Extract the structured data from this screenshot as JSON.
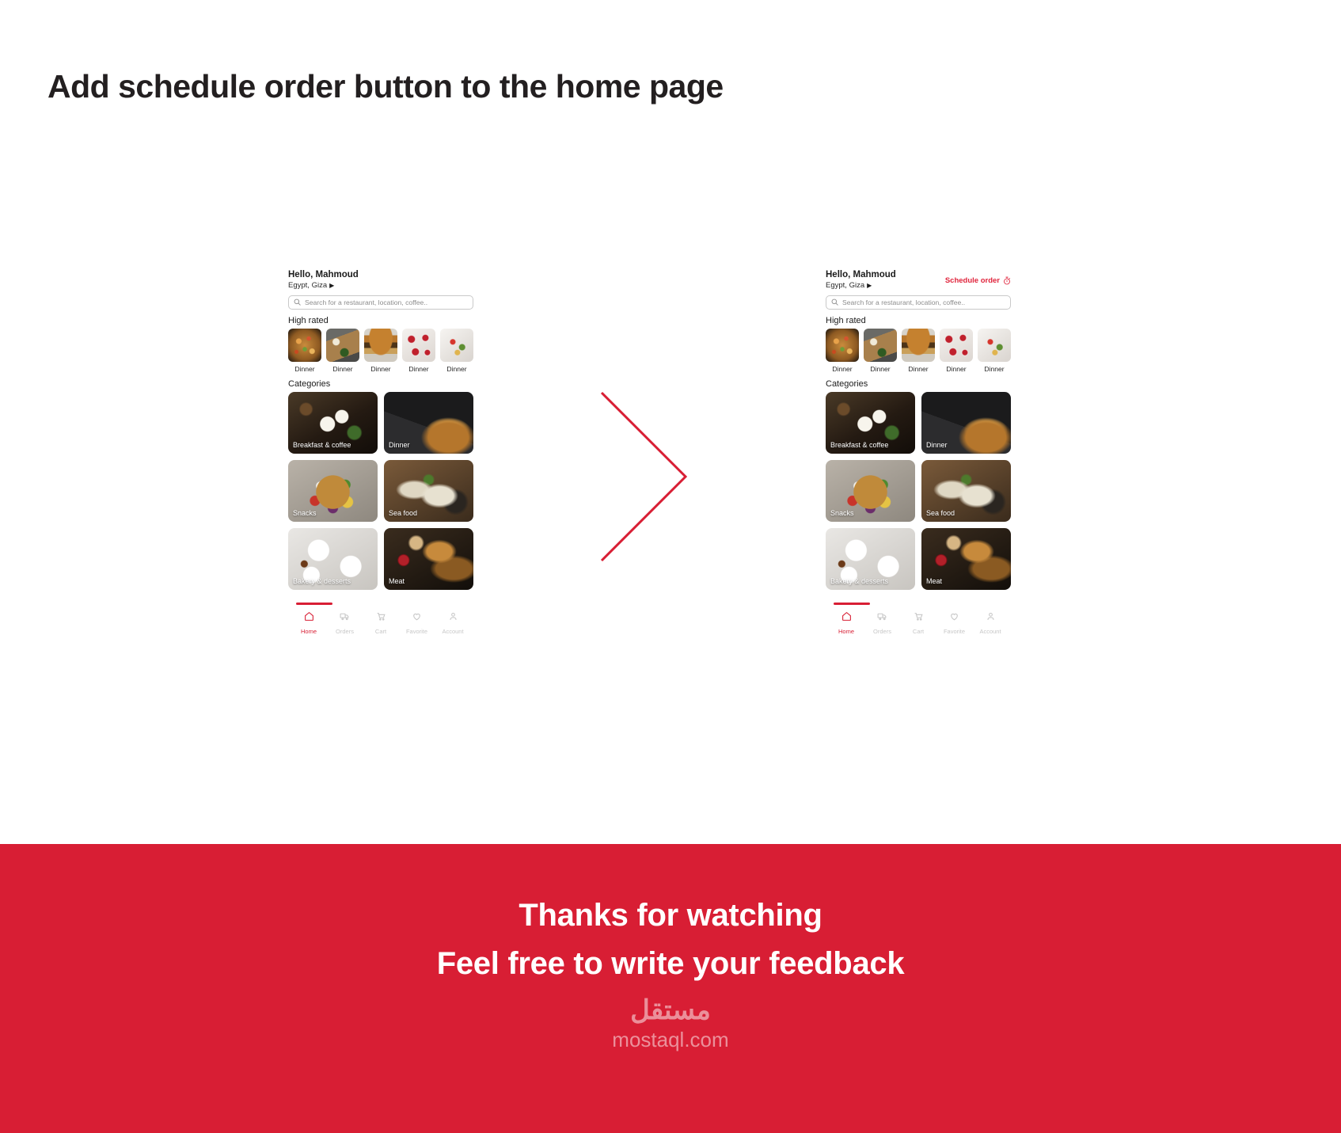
{
  "slide": {
    "title": "Add schedule order button to the home page"
  },
  "accent_colors": {
    "brand_red": "#d81e34",
    "schedule_red": "#e0243c",
    "title_dark": "#231f20",
    "muted_grey": "#8d8d8d"
  },
  "arrow": {
    "name": "chevron-right-arrow",
    "color": "#d81e34"
  },
  "phone_before": {
    "label": "before-state",
    "greeting": "Hello, Mahmoud",
    "location": "Egypt, Giza",
    "location_caret": "▶",
    "schedule_button_visible": false,
    "schedule_button_label": "",
    "search": {
      "placeholder": "Search for a restaurant, location, coffee..",
      "value": "",
      "icon": "search-icon"
    },
    "high_rated": {
      "title": "High rated",
      "items": [
        {
          "label": "Dinner",
          "image": "paella-skillet"
        },
        {
          "label": "Dinner",
          "image": "cutting-board-veggies"
        },
        {
          "label": "Dinner",
          "image": "chicken-burger"
        },
        {
          "label": "Dinner",
          "image": "strawberry-tarts"
        },
        {
          "label": "Dinner",
          "image": "salad-bowl-white"
        }
      ]
    },
    "categories": {
      "title": "Categories",
      "items": [
        {
          "name": "Breakfast & coffee",
          "image": "eggs-avocado-toast"
        },
        {
          "name": "Dinner",
          "image": "dark-burger"
        },
        {
          "name": "Snacks",
          "image": "buddha-bowl"
        },
        {
          "name": "Sea food",
          "image": "grilled-seafood"
        },
        {
          "name": "Bakery & desserts",
          "image": "pasta-plates"
        },
        {
          "name": "Meat",
          "image": "roast-meat-pan"
        }
      ]
    },
    "bottom_nav": {
      "items": [
        {
          "label": "Home",
          "icon": "home-icon",
          "active": true
        },
        {
          "label": "Orders",
          "icon": "truck-icon",
          "active": false
        },
        {
          "label": "Cart",
          "icon": "cart-icon",
          "active": false
        },
        {
          "label": "Favorite",
          "icon": "heart-icon",
          "active": false
        },
        {
          "label": "Account",
          "icon": "person-icon",
          "active": false
        }
      ]
    }
  },
  "phone_after": {
    "label": "after-state",
    "greeting": "Hello, Mahmoud",
    "location": "Egypt, Giza",
    "location_caret": "▶",
    "schedule_button_visible": true,
    "schedule_button_label": "Schedule order",
    "schedule_button_icon": "stopwatch-timer-icon",
    "search": {
      "placeholder": "Search for a restaurant, location, coffee..",
      "value": "",
      "icon": "search-icon"
    },
    "high_rated": {
      "title": "High rated",
      "items": [
        {
          "label": "Dinner",
          "image": "paella-skillet"
        },
        {
          "label": "Dinner",
          "image": "cutting-board-veggies"
        },
        {
          "label": "Dinner",
          "image": "chicken-burger"
        },
        {
          "label": "Dinner",
          "image": "strawberry-tarts"
        },
        {
          "label": "Dinner",
          "image": "salad-bowl-white"
        }
      ]
    },
    "categories": {
      "title": "Categories",
      "items": [
        {
          "name": "Breakfast & coffee",
          "image": "eggs-avocado-toast"
        },
        {
          "name": "Dinner",
          "image": "dark-burger"
        },
        {
          "name": "Snacks",
          "image": "buddha-bowl"
        },
        {
          "name": "Sea food",
          "image": "grilled-seafood"
        },
        {
          "name": "Bakery & desserts",
          "image": "pasta-plates"
        },
        {
          "name": "Meat",
          "image": "roast-meat-pan"
        }
      ]
    },
    "bottom_nav": {
      "items": [
        {
          "label": "Home",
          "icon": "home-icon",
          "active": true
        },
        {
          "label": "Orders",
          "icon": "truck-icon",
          "active": false
        },
        {
          "label": "Cart",
          "icon": "cart-icon",
          "active": false
        },
        {
          "label": "Favorite",
          "icon": "heart-icon",
          "active": false
        },
        {
          "label": "Account",
          "icon": "person-icon",
          "active": false
        }
      ]
    }
  },
  "banner": {
    "line1": "Thanks for watching",
    "line2": "Feel free to write your feedback",
    "watermark_arabic": "مستقل",
    "watermark_latin": "mostaql.com"
  }
}
